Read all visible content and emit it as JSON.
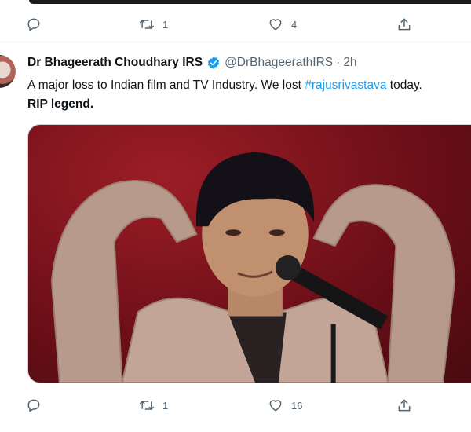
{
  "previous_tweet": {
    "actions": {
      "reply_count": "",
      "retweet_count": "1",
      "like_count": "4"
    }
  },
  "tweet": {
    "author_name": "Dr Bhageerath Choudhary IRS",
    "verified": true,
    "handle": "@DrBhageerathIRS",
    "separator": "·",
    "time": "2h",
    "text_part1": "A major loss to Indian film and TV Industry. We lost ",
    "hashtag": "#rajusrivastava",
    "text_part2": " today.",
    "text_line2": "RIP legend.",
    "actions": {
      "reply_count": "",
      "retweet_count": "1",
      "like_count": "16"
    }
  },
  "colors": {
    "accent": "#1d9bf0",
    "text_primary": "#0f1419",
    "text_secondary": "#536471",
    "divider": "#eff3f4"
  },
  "icons": {
    "reply": "reply-icon",
    "retweet": "retweet-icon",
    "like": "heart-icon",
    "share": "share-icon",
    "verified": "verified-badge-icon"
  }
}
